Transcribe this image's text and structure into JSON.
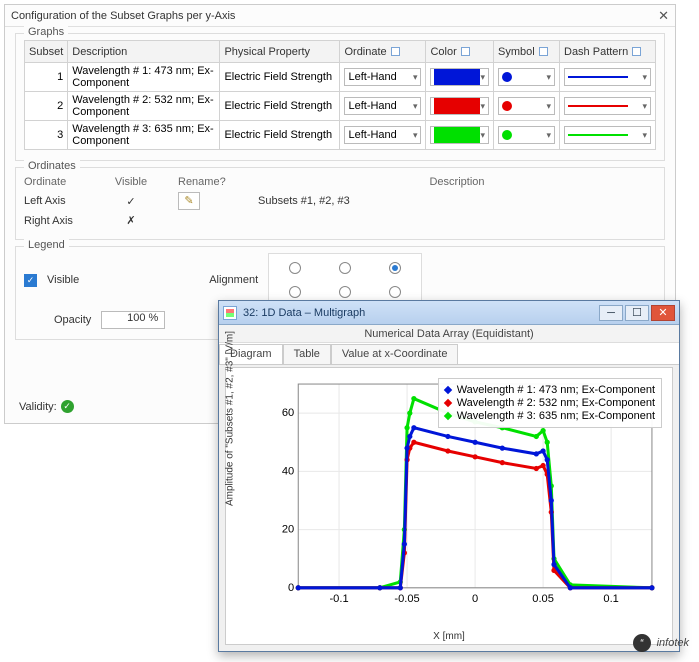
{
  "config": {
    "title": "Configuration of the Subset Graphs per y-Axis",
    "graphs_group": "Graphs",
    "headers": {
      "subset": "Subset",
      "desc": "Description",
      "phys": "Physical Property",
      "ord": "Ordinate",
      "color": "Color",
      "sym": "Symbol",
      "dash": "Dash Pattern"
    },
    "rows": [
      {
        "subset": "1",
        "desc": "Wavelength # 1: 473 nm; Ex-Component",
        "phys": "Electric Field Strength",
        "ord": "Left-Hand",
        "color": "blue"
      },
      {
        "subset": "2",
        "desc": "Wavelength # 2: 532 nm; Ex-Component",
        "phys": "Electric Field Strength",
        "ord": "Left-Hand",
        "color": "red"
      },
      {
        "subset": "3",
        "desc": "Wavelength # 3: 635 nm; Ex-Component",
        "phys": "Electric Field Strength",
        "ord": "Left-Hand",
        "color": "green"
      }
    ],
    "ord_group": "Ordinates",
    "ord_headers": {
      "ord": "Ordinate",
      "vis": "Visible",
      "ren": "Rename?",
      "desc": "Description"
    },
    "ord_rows": [
      {
        "ord": "Left Axis",
        "vis": "✓",
        "desc": "Subsets #1, #2, #3"
      },
      {
        "ord": "Right Axis",
        "vis": "✗",
        "desc": ""
      }
    ],
    "legend_group": "Legend",
    "legend_visible": "Visible",
    "legend_opacity_lbl": "Opacity",
    "legend_opacity_val": "100 %",
    "legend_align": "Alignment",
    "validity": "Validity:"
  },
  "mg": {
    "title": "32: 1D Data – Multigraph",
    "subtitle": "Numerical Data Array (Equidistant)",
    "tabs": [
      "Diagram",
      "Table",
      "Value at x-Coordinate"
    ],
    "legend": [
      "Wavelength # 1: 473 nm; Ex-Component",
      "Wavelength # 2: 532 nm; Ex-Component",
      "Wavelength # 3: 635 nm; Ex-Component"
    ],
    "ylabel": "Amplitude of \"Subsets #1, #2, #3\" [V/m]",
    "xlabel": "X [mm]",
    "yticks": [
      "0",
      "20",
      "40",
      "60"
    ],
    "xticks": [
      "-0.1",
      "-0.05",
      "0",
      "0.05",
      "0.1"
    ]
  },
  "chart_data": {
    "type": "line",
    "xlabel": "X [mm]",
    "ylabel": "Amplitude [V/m]",
    "xlim": [
      -0.13,
      0.13
    ],
    "ylim": [
      0,
      70
    ],
    "x": [
      -0.13,
      -0.07,
      -0.055,
      -0.052,
      -0.05,
      -0.048,
      -0.045,
      -0.02,
      0,
      0.02,
      0.045,
      0.05,
      0.053,
      0.056,
      0.058,
      0.07,
      0.13
    ],
    "series": [
      {
        "name": "Wavelength # 1: 473 nm (blue)",
        "color": "#0016d8",
        "values": [
          0,
          0,
          0,
          15,
          48,
          52,
          55,
          52,
          50,
          48,
          46,
          47,
          44,
          30,
          8,
          0,
          0
        ]
      },
      {
        "name": "Wavelength # 2: 532 nm (red)",
        "color": "#e60000",
        "values": [
          0,
          0,
          0,
          12,
          44,
          48,
          50,
          47,
          45,
          43,
          41,
          42,
          39,
          26,
          6,
          0,
          0
        ]
      },
      {
        "name": "Wavelength # 3: 635 nm (green)",
        "color": "#00e000",
        "values": [
          0,
          0,
          2,
          20,
          55,
          60,
          65,
          60,
          57,
          55,
          52,
          54,
          50,
          35,
          10,
          1,
          0
        ]
      }
    ]
  },
  "watermark": "infotek"
}
